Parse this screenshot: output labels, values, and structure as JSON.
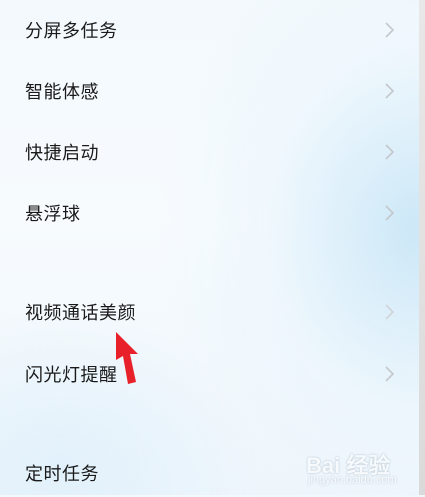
{
  "menu": {
    "items": [
      {
        "label": "分屏多任务"
      },
      {
        "label": "智能体感"
      },
      {
        "label": "快捷启动"
      },
      {
        "label": "悬浮球"
      },
      {
        "label": "视频通话美颜"
      },
      {
        "label": "闪光灯提醒"
      },
      {
        "label": "定时任务"
      }
    ]
  },
  "annotation": {
    "arrow_color": "#e8202a"
  },
  "watermark": {
    "brand": "Bai 经验",
    "site": "jingyan.baidu.com"
  },
  "colors": {
    "text": "#1a1a1a",
    "chevron": "#c4c8cc"
  }
}
